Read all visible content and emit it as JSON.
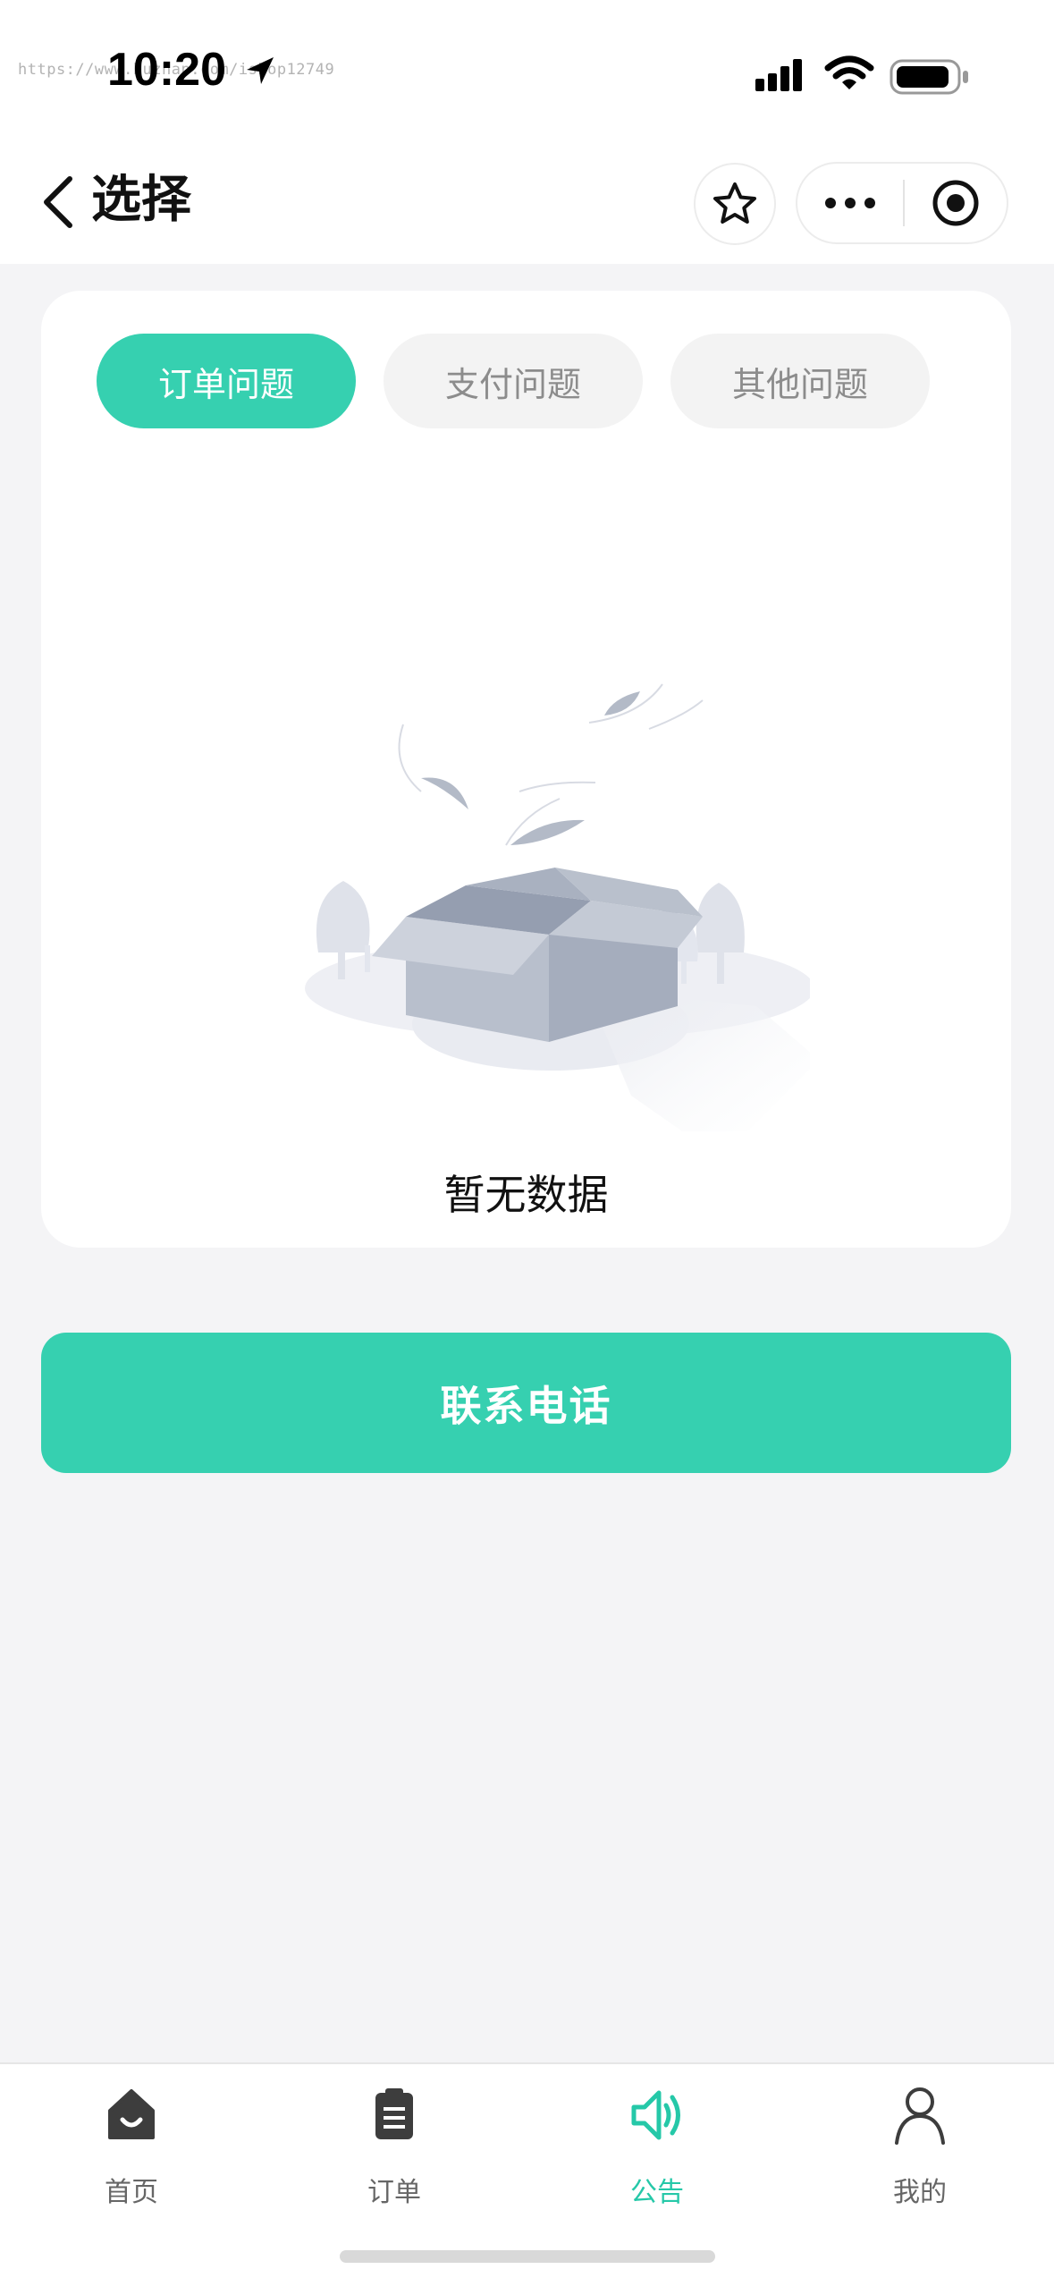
{
  "status_bar": {
    "watermark": "https://www.huzhan.com/ishop12749",
    "time": "10:20"
  },
  "nav": {
    "title": "选择",
    "icons": [
      "back-icon",
      "star-icon",
      "more-icon",
      "target-icon"
    ]
  },
  "tabs": [
    {
      "label": "订单问题",
      "active": true
    },
    {
      "label": "支付问题",
      "active": false
    },
    {
      "label": "其他问题",
      "active": false
    }
  ],
  "empty_state": {
    "text": "暂无数据",
    "icon": "empty-box-illustration"
  },
  "contact_button": {
    "label": "联系电话"
  },
  "tabbar": {
    "items": [
      {
        "label": "首页",
        "icon": "home-icon",
        "active": false
      },
      {
        "label": "订单",
        "icon": "order-icon",
        "active": false
      },
      {
        "label": "公告",
        "icon": "announcement-icon",
        "active": true
      },
      {
        "label": "我的",
        "icon": "user-icon",
        "active": false
      }
    ]
  },
  "colors": {
    "accent": "#36d0b0",
    "background": "#f4f4f6",
    "card": "#ffffff",
    "inactive_tab": "#f3f3f3",
    "inactive_text": "#8c8c8c"
  }
}
